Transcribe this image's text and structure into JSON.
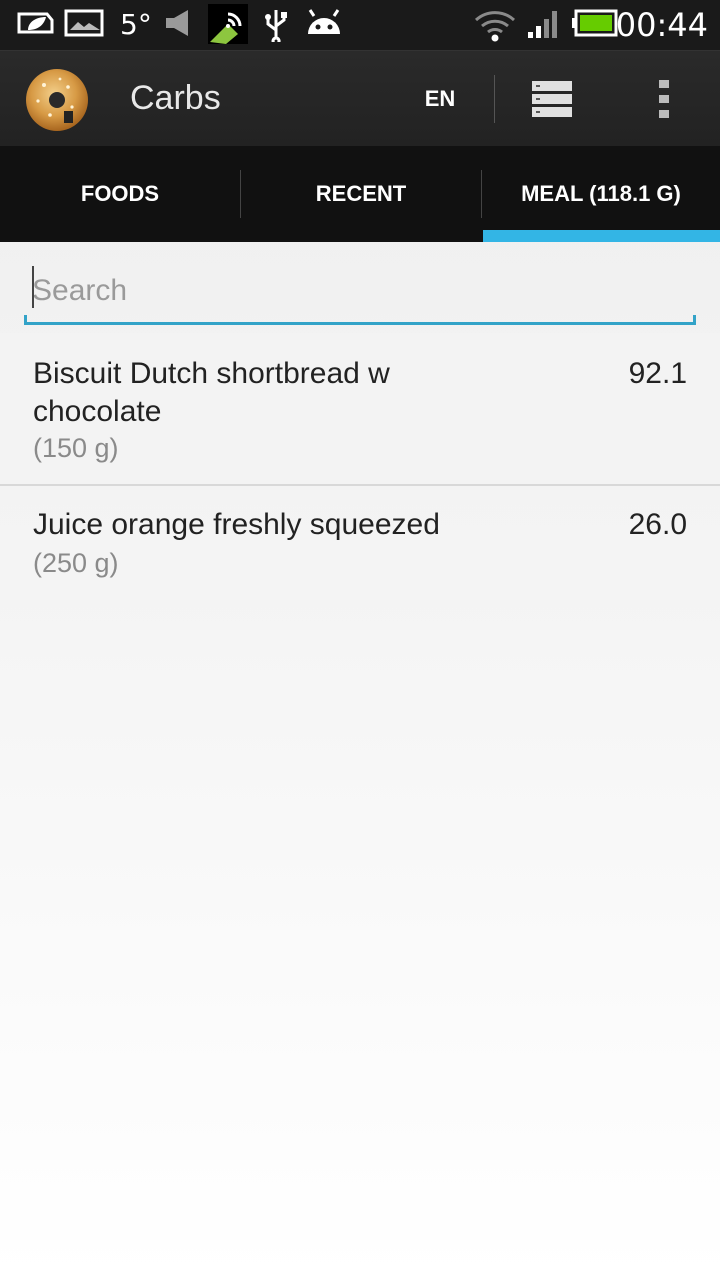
{
  "status_bar": {
    "temperature": "5°",
    "time": "00:44",
    "icons": [
      "leaf-battery-icon",
      "photo-icon",
      "temperature",
      "speaker-icon",
      "nfc-icon",
      "usb-icon",
      "android-icon",
      "wifi-icon",
      "signal-icon",
      "battery-icon"
    ],
    "battery_color": "#66cc00"
  },
  "action_bar": {
    "title": "Carbs",
    "language": "EN"
  },
  "tabs": [
    {
      "label": "FOODS",
      "selected": false
    },
    {
      "label": "RECENT",
      "selected": false
    },
    {
      "label": "MEAL (118.1 G)",
      "selected": true
    }
  ],
  "accent_color": "#33b5e5",
  "search": {
    "placeholder": "Search",
    "value": ""
  },
  "meal_items": [
    {
      "name": "Biscuit Dutch shortbread w chocolate",
      "quantity": "(150 g)",
      "carbs": "92.1"
    },
    {
      "name": "Juice orange freshly squeezed",
      "quantity": "(250 g)",
      "carbs": "26.0"
    }
  ]
}
